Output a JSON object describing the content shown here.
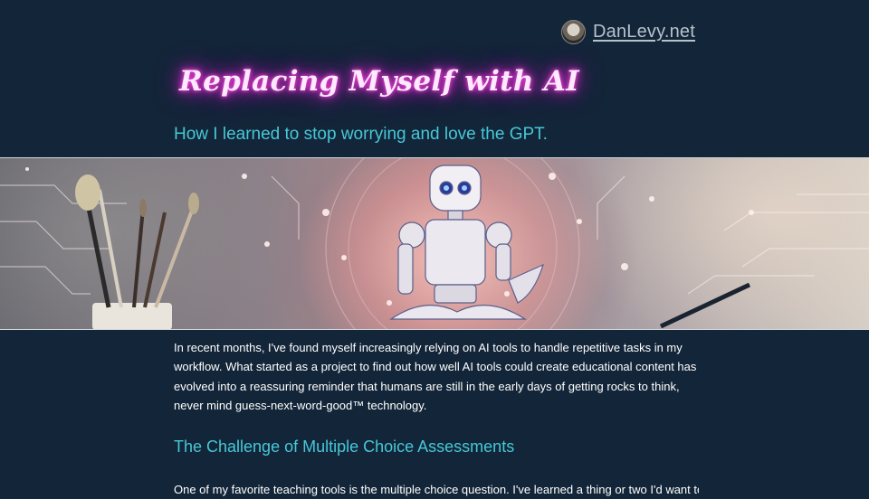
{
  "header": {
    "site_link": "DanLevy.net",
    "avatar_alt": "Dan Levy avatar"
  },
  "article": {
    "title": "Replacing Myself with AI",
    "subtitle": "How I learned to stop worrying and love the GPT.",
    "hero_image_alt": "Robot meditating among circuit lines with paint brushes in a cup",
    "intro_paragraph": "In recent months, I've found myself increasingly relying on AI tools to handle repetitive tasks in my workflow. What started as a project to find out how well AI tools could create educational content has evolved into a reassuring reminder that humans are still in the early days of getting rocks to think, never mind guess-next-word-good™ technology.",
    "section_heading": "The Challenge of Multiple Choice Assessments",
    "next_paragraph_partial": "One of my favorite teaching tools is the multiple choice question. I've learned a thing or two I'd want to"
  },
  "colors": {
    "background": "#132538",
    "accent_cyan": "#45c8d8",
    "title_glow": "#e233d2",
    "link_gray": "#b8c2cc"
  }
}
